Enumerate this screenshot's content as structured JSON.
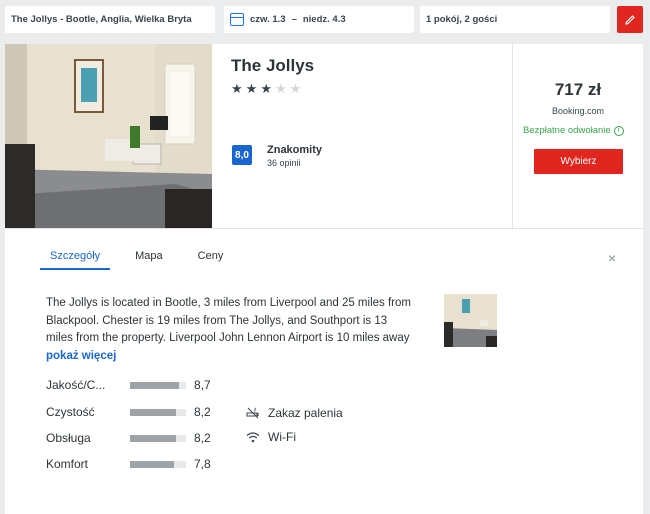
{
  "search": {
    "destination": "The Jollys - Bootle, Anglia, Wielka Bryta",
    "checkin": "czw. 1.3",
    "separator": "–",
    "checkout": "niedz. 4.3",
    "guests": "1 pokój, 2 gości",
    "calendar_icon": "calendar-icon",
    "edit_icon": "pencil-icon"
  },
  "hotel": {
    "name": "The Jollys",
    "stars_total": 5,
    "stars_filled": 3,
    "score": "8,0",
    "score_label": "Znakomity",
    "reviews": "36 opinii"
  },
  "offer": {
    "price": "717 zł",
    "provider": "Booking.com",
    "cancellation": "Bezpłatne odwołanie",
    "select_label": "Wybierz"
  },
  "tabs": [
    {
      "label": "Szczegóły",
      "active": true
    },
    {
      "label": "Mapa",
      "active": false
    },
    {
      "label": "Ceny",
      "active": false
    }
  ],
  "close_label": "×",
  "details": {
    "description": "The Jollys is located in Bootle, 3 miles from Liverpool and 25 miles from Blackpool. Chester is 19 miles from The Jollys, and Southport is 13 miles from the property. Liverpool John Lennon Airport is 10 miles away",
    "more_label": "pokaż więcej"
  },
  "ratings": [
    {
      "label": "Jakość/C...",
      "value": "8,7",
      "fraction": 0.87
    },
    {
      "label": "Czystość",
      "value": "8,2",
      "fraction": 0.82
    },
    {
      "label": "Obsługa",
      "value": "8,2",
      "fraction": 0.82
    },
    {
      "label": "Komfort",
      "value": "7,8",
      "fraction": 0.78
    }
  ],
  "amenities": [
    {
      "label": "Zakaz palenia",
      "icon": "no-smoking-icon"
    },
    {
      "label": "Wi-Fi",
      "icon": "wifi-icon"
    }
  ]
}
